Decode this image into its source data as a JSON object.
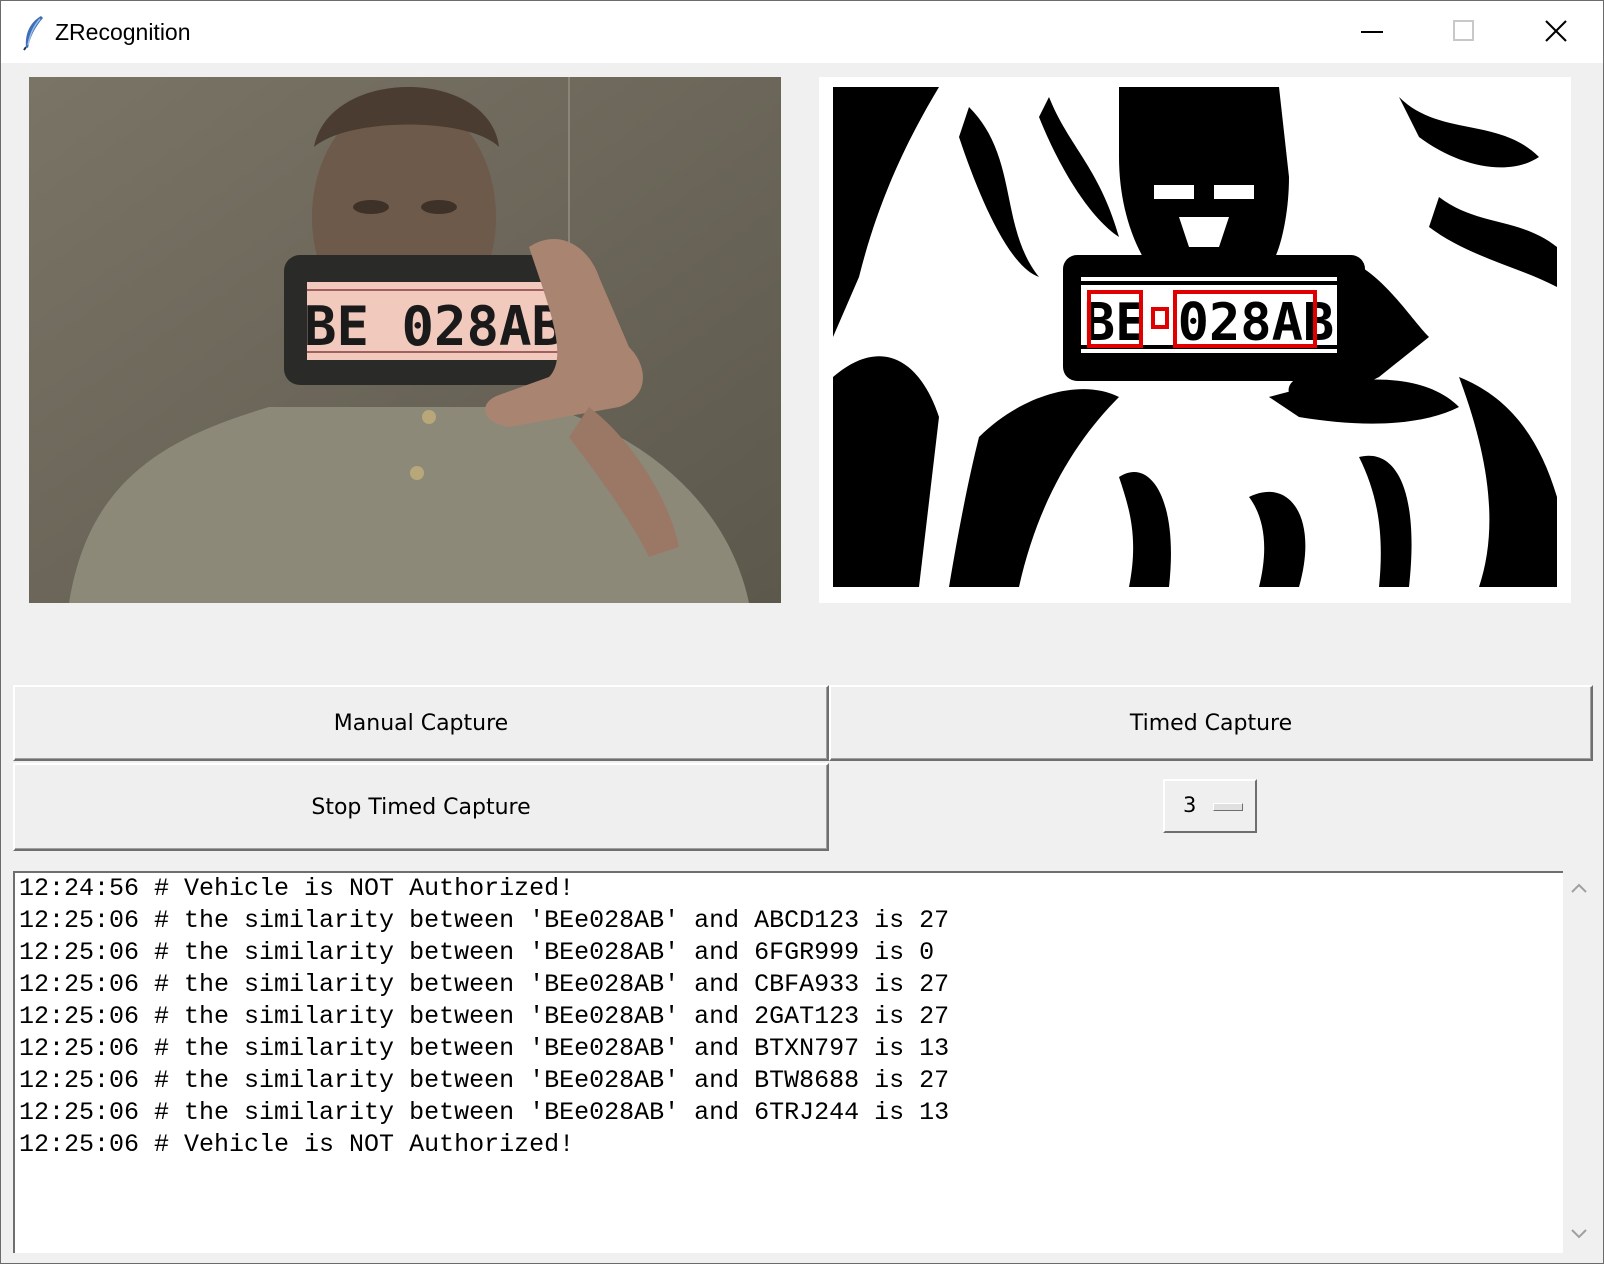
{
  "window": {
    "title": "ZRecognition",
    "icon": "feather-icon",
    "controls": [
      "minimize-icon",
      "maximize-icon",
      "close-icon"
    ]
  },
  "camera_view": {
    "plate_text": "BE 028AB"
  },
  "processed_view": {
    "plate_text": "BE 028AB",
    "highlight_color": "#e00000"
  },
  "buttons": {
    "manual_capture": "Manual Capture",
    "timed_capture": "Timed Capture",
    "stop_timed_capture": "Stop Timed Capture"
  },
  "interval_select": {
    "value": "3"
  },
  "log": {
    "lines": [
      "12:24:56 # Vehicle is NOT Authorized!",
      "12:25:06 # the similarity between 'BEe028AB' and ABCD123 is 27",
      "12:25:06 # the similarity between 'BEe028AB' and 6FGR999 is 0",
      "12:25:06 # the similarity between 'BEe028AB' and CBFA933 is 27",
      "12:25:06 # the similarity between 'BEe028AB' and 2GAT123 is 27",
      "12:25:06 # the similarity between 'BEe028AB' and BTXN797 is 13",
      "12:25:06 # the similarity between 'BEe028AB' and BTW8688 is 27",
      "12:25:06 # the similarity between 'BEe028AB' and 6TRJ244 is 13",
      "12:25:06 # Vehicle is NOT Authorized!"
    ]
  },
  "scrollbar": [
    "scroll-up-icon",
    "scroll-down-icon"
  ]
}
